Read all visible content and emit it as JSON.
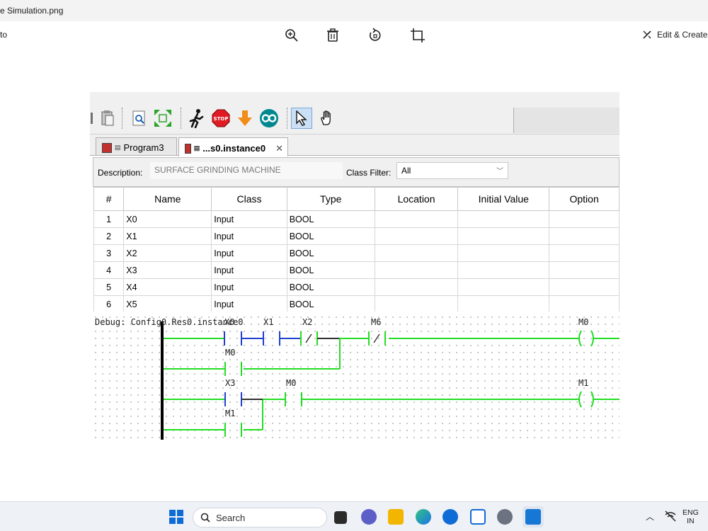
{
  "window": {
    "title_fragment": "e Simulation.png",
    "left_fragment": "to"
  },
  "viewer_toolbar": {
    "icons": [
      "zoom-in-icon",
      "delete-icon",
      "rotate-icon",
      "crop-icon"
    ],
    "edit_create_label": "Edit & Create"
  },
  "ide": {
    "tabs": [
      {
        "label": "Program3",
        "active": false
      },
      {
        "label": "...s0.instance0",
        "active": true,
        "close": "✕"
      }
    ],
    "description_label": "Description:",
    "description_value": "SURFACE GRINDING MACHINE",
    "class_filter_label": "Class Filter:",
    "class_filter_value": "All",
    "table": {
      "headers": [
        "#",
        "Name",
        "Class",
        "Type",
        "Location",
        "Initial Value",
        "Option"
      ],
      "rows": [
        [
          "1",
          "X0",
          "Input",
          "BOOL",
          "",
          "",
          ""
        ],
        [
          "2",
          "X1",
          "Input",
          "BOOL",
          "",
          "",
          ""
        ],
        [
          "3",
          "X2",
          "Input",
          "BOOL",
          "",
          "",
          ""
        ],
        [
          "4",
          "X3",
          "Input",
          "BOOL",
          "",
          "",
          ""
        ],
        [
          "5",
          "X4",
          "Input",
          "BOOL",
          "",
          "",
          ""
        ],
        [
          "6",
          "X5",
          "Input",
          "BOOL",
          "",
          "",
          ""
        ]
      ]
    },
    "ladder": {
      "debug_text": "Debug: Config0.Res0.instance0",
      "labels": {
        "x0": "X0",
        "x1": "X1",
        "x2": "X2",
        "m6": "M6",
        "coil_m0": "M0",
        "m0_seal": "M0",
        "x3": "X3",
        "m0": "M0",
        "coil_m1": "M1",
        "m1_seal": "M1"
      },
      "colors": {
        "energized": "#22dd22",
        "open_contact": "#1f3fcf",
        "rail": "#000000"
      }
    }
  },
  "taskbar": {
    "search_placeholder": "Search",
    "lang_line1": "ENG",
    "lang_line2": "IN"
  }
}
